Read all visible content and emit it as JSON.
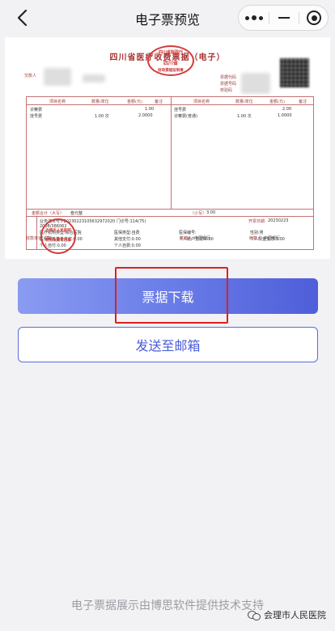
{
  "navbar": {
    "title": "电子票预览",
    "back_icon": "chevron-left-icon",
    "more_icon": "more-dots-icon",
    "minimize_icon": "minus-icon",
    "close_icon": "target-circle-icon"
  },
  "receipt": {
    "title": "四川省医疗收费票据（电子）",
    "labels": {
      "payer": "交款人",
      "code": "票据代码",
      "number": "票据号码",
      "check_code": "校验码",
      "date": "开票日期",
      "bank_credit_1": "中国银行",
      "bank_credit_2": "中国银行"
    },
    "table": {
      "headers": [
        "项目名称",
        "数量/单位",
        "金额(元)",
        "备注",
        "项目名称",
        "数量/单位",
        "金额(元)",
        "备注"
      ],
      "rows": [
        [
          "诊察费",
          "",
          "1.00",
          "",
          "挂号费",
          "",
          "2.00",
          ""
        ],
        [
          "挂号费",
          "1.00 次",
          "2.0000",
          "",
          "诊察费(普通)",
          "1.00 次",
          "1.0000",
          ""
        ]
      ],
      "total_label": "金额合计（大写）",
      "total_upper": "叁元整",
      "total_lower_label": "（小写）",
      "total_lower": "3.00",
      "remarks": [
        "业务流水号:F20230223105632972020 门诊号:114(75)",
        "2008/386062",
        "医疗机构类型:综合医院",
        "医保类型:自费",
        "医保编号:",
        "性别:男",
        "医保统筹基金支付:0.00",
        "其他支付:0.00",
        "个人账户支付:0.00",
        "个人现金支付:3.00",
        "个人自付:0.00",
        "个人自费:0.00"
      ],
      "invoice_date_value": "20230223"
    },
    "payee_unit": "收款单位（章）",
    "reviewer": "复核人",
    "payee": "收款人",
    "stamp_top": "四川省财政厅",
    "stamp_mid": "四川省",
    "stamp_bottom": "财政票据监制章",
    "stamp2_top": "会理市人民医院",
    "stamp2_bottom": "财务收费专用章"
  },
  "buttons": {
    "download": "票据下载",
    "email": "发送至邮箱"
  },
  "footer": "电子票据展示由博思软件提供技术支持",
  "watermark": "会理市人民医院",
  "colors": {
    "download_gradient": [
      "#8a9bf2",
      "#4f5ed9"
    ],
    "email_border": "#5a6be0",
    "highlight_box": "#e01f1f"
  }
}
